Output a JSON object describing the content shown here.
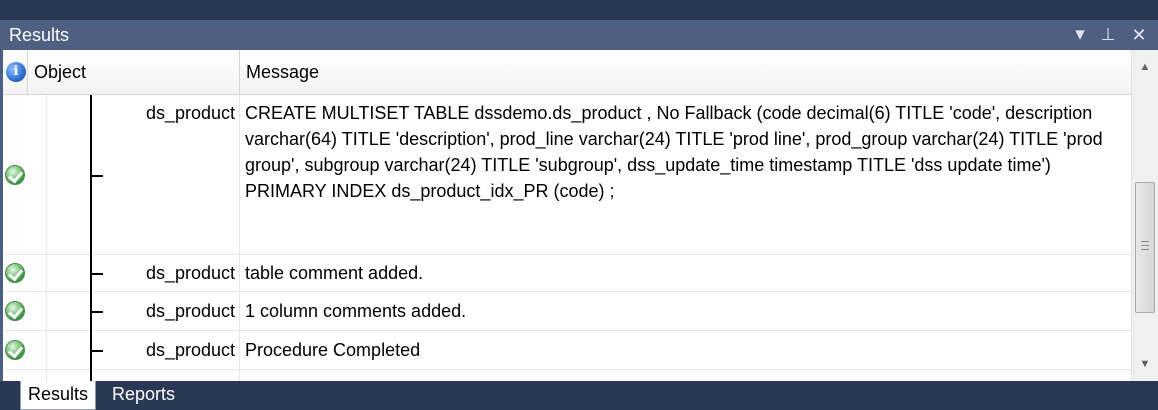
{
  "panel": {
    "title": "Results",
    "controls": {
      "menu": "▾",
      "pin": "⊥",
      "close": "✕"
    }
  },
  "columns": {
    "status_icon": "info-icon",
    "object": "Object",
    "message": "Message"
  },
  "rows": [
    {
      "status": "success",
      "object": "ds_product",
      "message": "CREATE MULTISET TABLE dssdemo.ds_product , No Fallback (code decimal(6) TITLE 'code', description varchar(64) TITLE 'description', prod_line varchar(24) TITLE 'prod line', prod_group varchar(24) TITLE 'prod group', subgroup varchar(24) TITLE 'subgroup', dss_update_time timestamp TITLE 'dss update time')  PRIMARY INDEX ds_product_idx_PR (code)  ;"
    },
    {
      "status": "success",
      "object": "ds_product",
      "message": "table comment added."
    },
    {
      "status": "success",
      "object": "ds_product",
      "message": "1 column comments added."
    },
    {
      "status": "success",
      "object": "ds_product",
      "message": "Procedure Completed"
    }
  ],
  "tabs": [
    {
      "label": "Results",
      "active": true
    },
    {
      "label": "Reports",
      "active": false
    }
  ],
  "scrollbar": {
    "up": "▲",
    "down": "▼"
  },
  "colors": {
    "frame": "#293955",
    "titlebar": "#4d6082",
    "success": "#3c9a42"
  }
}
